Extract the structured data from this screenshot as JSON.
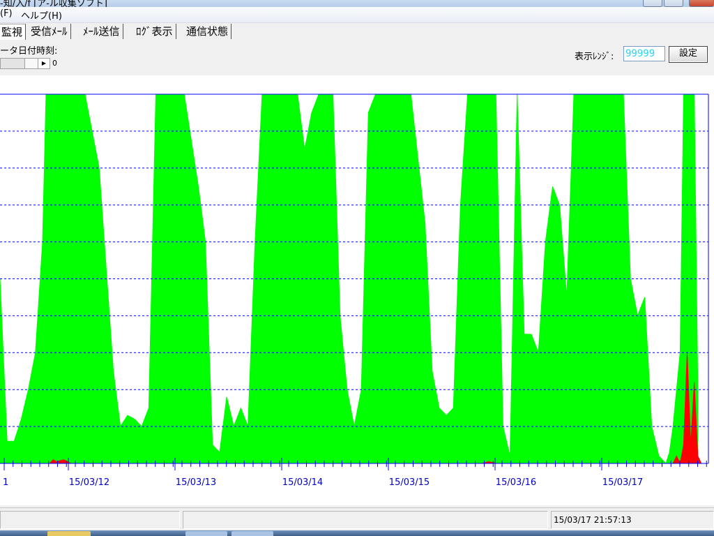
{
  "window": {
    "title": "-知/入/f [ア-ル収集ソフト]"
  },
  "menu": {
    "items": [
      "(F)",
      "ヘルプ(H)"
    ]
  },
  "tabs": [
    {
      "label": "監視"
    },
    {
      "label": "受信ﾒｰﾙ"
    },
    {
      "label": "ﾒｰﾙ送信"
    },
    {
      "label": "ﾛｸﾞ表示"
    },
    {
      "label": "通信状態"
    }
  ],
  "controls": {
    "data_time_label": "ータ日付時刻:",
    "scroll_value": "0",
    "range_label": "表示ﾚﾝｼﾞ:",
    "range_value": "99999",
    "set_button": "設定"
  },
  "status": {
    "datetime": "15/03/17 21:57:13"
  },
  "colors": {
    "series_main": "#00ff00",
    "series_alarm": "#ff0000",
    "frame": "#0000ff",
    "range_text": "#27d7ee"
  },
  "chart_data": {
    "type": "area",
    "x_labels": [
      "1",
      "15/03/12",
      "15/03/13",
      "15/03/14",
      "15/03/15",
      "15/03/16",
      "15/03/17"
    ],
    "grid": true,
    "series": [
      {
        "color": "#00ff00",
        "points": [
          [
            0,
            0.5
          ],
          [
            0.01,
            0.06
          ],
          [
            0.02,
            0.06
          ],
          [
            0.03,
            0.12
          ],
          [
            0.04,
            0.2
          ],
          [
            0.05,
            0.3
          ],
          [
            0.06,
            0.6
          ],
          [
            0.065,
            1
          ],
          [
            0.12,
            1
          ],
          [
            0.14,
            0.8
          ],
          [
            0.16,
            0.25
          ],
          [
            0.17,
            0.1
          ],
          [
            0.18,
            0.13
          ],
          [
            0.19,
            0.12
          ],
          [
            0.2,
            0.1
          ],
          [
            0.21,
            0.15
          ],
          [
            0.22,
            1
          ],
          [
            0.26,
            1
          ],
          [
            0.28,
            0.75
          ],
          [
            0.29,
            0.6
          ],
          [
            0.3,
            0.05
          ],
          [
            0.31,
            0.03
          ],
          [
            0.32,
            0.18
          ],
          [
            0.33,
            0.1
          ],
          [
            0.34,
            0.15
          ],
          [
            0.35,
            0.1
          ],
          [
            0.36,
            0.6
          ],
          [
            0.37,
            1
          ],
          [
            0.42,
            1
          ],
          [
            0.43,
            0.85
          ],
          [
            0.44,
            0.95
          ],
          [
            0.45,
            1
          ],
          [
            0.47,
            1
          ],
          [
            0.48,
            0.4
          ],
          [
            0.49,
            0.2
          ],
          [
            0.5,
            0.1
          ],
          [
            0.51,
            0.2
          ],
          [
            0.52,
            0.95
          ],
          [
            0.53,
            1
          ],
          [
            0.58,
            1
          ],
          [
            0.6,
            0.65
          ],
          [
            0.61,
            0.25
          ],
          [
            0.62,
            0.15
          ],
          [
            0.63,
            0.13
          ],
          [
            0.64,
            0.15
          ],
          [
            0.65,
            0.7
          ],
          [
            0.66,
            1
          ],
          [
            0.7,
            1
          ],
          [
            0.71,
            0.1
          ],
          [
            0.72,
            0.02
          ],
          [
            0.73,
            1
          ],
          [
            0.74,
            0.35
          ],
          [
            0.75,
            0.35
          ],
          [
            0.76,
            0.3
          ],
          [
            0.77,
            0.6
          ],
          [
            0.78,
            0.75
          ],
          [
            0.79,
            0.7
          ],
          [
            0.8,
            0.45
          ],
          [
            0.81,
            1
          ],
          [
            0.88,
            1
          ],
          [
            0.89,
            0.5
          ],
          [
            0.9,
            0.4
          ],
          [
            0.91,
            0.45
          ],
          [
            0.92,
            0.1
          ],
          [
            0.93,
            0.02
          ],
          [
            0.94,
            0
          ],
          [
            0.945,
            0.03
          ],
          [
            0.95,
            0.1
          ],
          [
            0.96,
            0.3
          ],
          [
            0.965,
            1
          ],
          [
            0.98,
            1
          ],
          [
            0.985,
            0.2
          ]
        ]
      },
      {
        "color": "#ff0000",
        "points": [
          [
            0.07,
            0
          ],
          [
            0.075,
            0.01
          ],
          [
            0.08,
            0.005
          ],
          [
            0.09,
            0.01
          ],
          [
            0.1,
            0
          ],
          [
            0.68,
            0
          ],
          [
            0.69,
            0.005
          ],
          [
            0.7,
            0
          ],
          [
            0.95,
            0
          ],
          [
            0.955,
            0.02
          ],
          [
            0.96,
            0
          ],
          [
            0.965,
            0.05
          ],
          [
            0.97,
            0.3
          ],
          [
            0.975,
            0.05
          ],
          [
            0.98,
            0.22
          ],
          [
            0.985,
            0.02
          ],
          [
            0.99,
            0
          ]
        ]
      }
    ]
  }
}
